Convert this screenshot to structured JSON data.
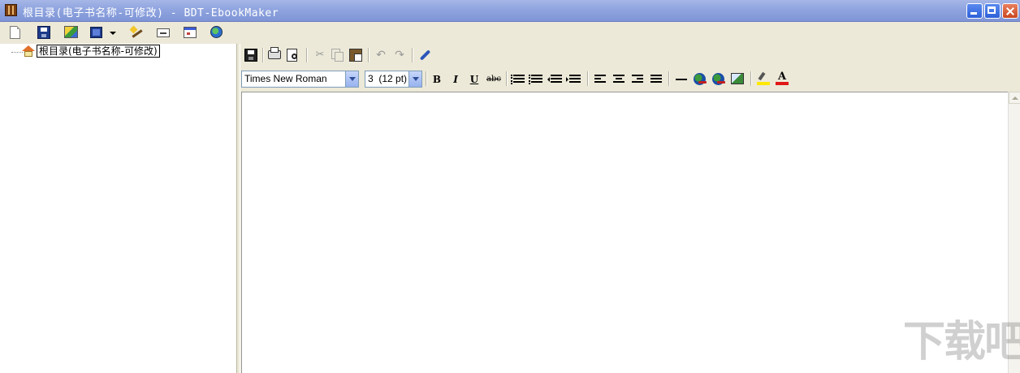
{
  "window": {
    "title": "根目录(电子书名称-可修改) - BDT-EbookMaker"
  },
  "main_toolbar": {
    "icons": [
      "new-file-icon",
      "save-icon",
      "insert-image-icon",
      "layout-icon",
      "chevron-down-icon",
      "wizard-wand-icon",
      "card-icon",
      "window-icon",
      "globe-icon"
    ]
  },
  "tree": {
    "root_label": "根目录(电子书名称-可修改)"
  },
  "editor": {
    "toolbar_icons": [
      "save-icon",
      "print-icon",
      "print-preview-icon",
      "cut-icon",
      "copy-icon",
      "paste-icon",
      "undo-icon",
      "redo-icon",
      "pen-icon"
    ],
    "font_name": "Times New Roman",
    "font_size": "3  (12 pt)",
    "format": {
      "bold": "B",
      "italic": "I",
      "underline": "U",
      "strike": "abc",
      "font_color_glyph": "A"
    },
    "content": ""
  },
  "colors": {
    "titlebar": "#8fa4df",
    "chrome": "#ece9d8",
    "highlight": "#ffe800",
    "font_color": "#e01818"
  },
  "watermark": "下载吧"
}
